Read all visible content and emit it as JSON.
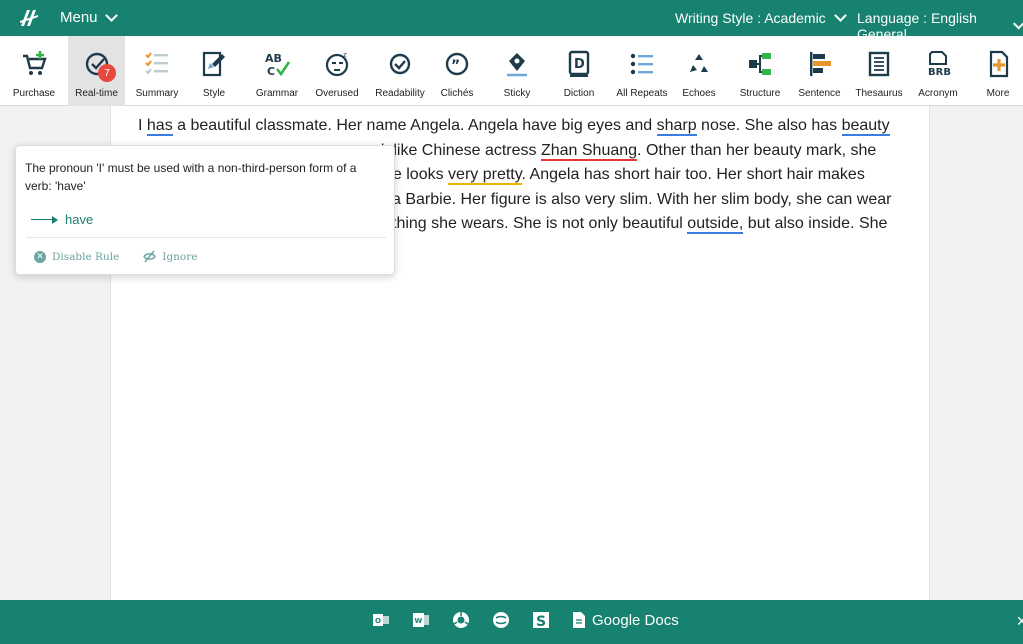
{
  "topbar": {
    "menu_label": "Menu",
    "writing_style": "Writing Style : Academic",
    "language": "Language : English General"
  },
  "toolbar": {
    "badge_count": "7",
    "tools": [
      {
        "label": "Purchase",
        "icon": "cart-icon"
      },
      {
        "label": "Real-time",
        "icon": "check-circle-icon"
      },
      {
        "label": "Summary",
        "icon": "list-check-icon"
      },
      {
        "label": "Style",
        "icon": "style-pen-icon"
      },
      {
        "label": "Grammar",
        "icon": "abc-check-icon"
      },
      {
        "label": "Overused",
        "icon": "sleepy-face-icon"
      },
      {
        "label": "Readability",
        "icon": "eye-icon"
      },
      {
        "label": "Clichés",
        "icon": "quote-bubble-icon"
      },
      {
        "label": "Sticky",
        "icon": "pen-nib-icon"
      },
      {
        "label": "Diction",
        "icon": "d-book-icon"
      },
      {
        "label": "All Repeats",
        "icon": "bullet-list-icon"
      },
      {
        "label": "Echoes",
        "icon": "recycle-icon"
      },
      {
        "label": "Structure",
        "icon": "structure-icon"
      },
      {
        "label": "Sentence",
        "icon": "sentence-bars-icon"
      },
      {
        "label": "Thesaurus",
        "icon": "book-icon"
      },
      {
        "label": "Acronym",
        "icon": "brb-doc-icon"
      },
      {
        "label": "More",
        "icon": "plus-doc-icon"
      }
    ]
  },
  "document": {
    "line1_a": "I ",
    "line1_has": "has",
    "line1_b": " a beautiful classmate. Her name Angela. Angela have big eyes and ",
    "line1_sharp": "sharp",
    "line1_c": " nose. She also has ",
    "line1_beauty": "beauty",
    "line2_a": "ok like  Chinese actress ",
    "line2_zhan": "Zhan Shuang",
    "line2_b": ". Other than her beauty mark, she",
    "line3_a": "he looks ",
    "line3_pretty": "very pretty",
    "line3_b": ". Angela has short hair too. Her short hair makes",
    "line4_a": " a Barbie. Her figure is also very slim. With her slim body, she can wear",
    "line5_a": "ything she wears. She is not only beautiful ",
    "line5_outside": "outside,",
    "line5_b": " but also inside. She"
  },
  "popover": {
    "message": "The pronoun 'I' must be used with a non-third-person form of a verb: 'have'",
    "suggestion": "have",
    "disable_rule": "Disable Rule",
    "ignore": "Ignore"
  },
  "bottombar": {
    "google_docs": "Google Docs",
    "icons": [
      "outlook-icon",
      "word-icon",
      "chrome-icon",
      "firefox-icon",
      "scrivener-icon",
      "google-docs-icon"
    ]
  },
  "colors": {
    "brand": "#17826f",
    "badge": "#e8493f",
    "underline_grammar": "#3b7de0",
    "underline_spelling": "#e53935",
    "underline_style": "#f0b400"
  }
}
